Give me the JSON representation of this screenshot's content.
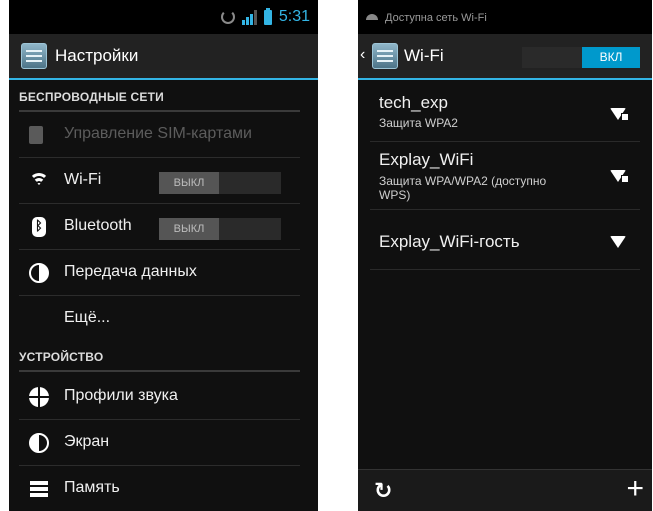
{
  "left": {
    "status_time": "5:31",
    "title": "Настройки",
    "sections": {
      "wireless": "БЕСПРОВОДНЫЕ СЕТИ",
      "device": "УСТРОЙСТВО"
    },
    "items": {
      "sim": "Управление SIM-картами",
      "wifi": "Wi-Fi",
      "bluetooth": "Bluetooth",
      "data": "Передача данных",
      "more": "Ещё...",
      "sound": "Профили звука",
      "screen": "Экран",
      "memory": "Память"
    },
    "wifi_toggle": "ВЫКЛ",
    "bluetooth_toggle": "ВЫКЛ"
  },
  "right": {
    "notification": "Доступна сеть Wi-Fi",
    "title": "Wi-Fi",
    "toggle": "ВКЛ",
    "networks": [
      {
        "name": "tech_exp",
        "security": "Защита WPA2"
      },
      {
        "name": "Explay_WiFi",
        "security": "Защита WPA/WPA2 (доступно WPS)"
      },
      {
        "name": "Explay_WiFi-гость",
        "security": ""
      }
    ],
    "add_symbol": "+"
  },
  "colors": {
    "accent": "#33b5e5",
    "toggle_on": "#0099cc",
    "background": "#101010"
  },
  "icons": [
    "sim-icon",
    "wifi-icon",
    "bluetooth-icon",
    "data-usage-icon",
    "sound-icon",
    "display-icon",
    "memory-icon",
    "wifi-signal-icon",
    "refresh-icon",
    "add-icon"
  ]
}
